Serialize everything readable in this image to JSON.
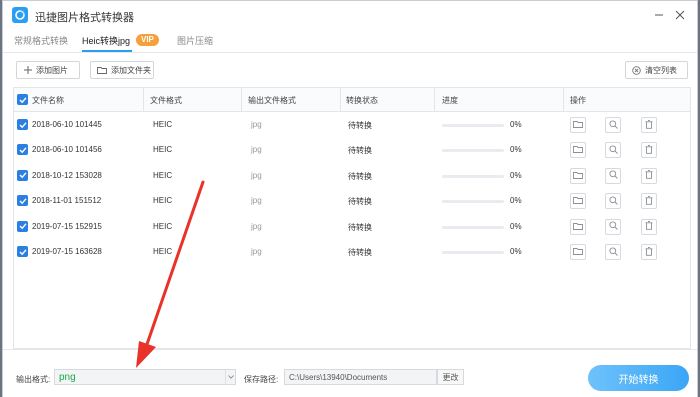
{
  "window": {
    "title": "迅捷图片格式转换器"
  },
  "tabs": [
    {
      "label": "常规格式转换"
    },
    {
      "label": "Heic转换jpg",
      "badge": "VIP"
    },
    {
      "label": "图片压缩"
    }
  ],
  "toolbar": {
    "add_image": "添加图片",
    "add_folder": "添加文件夹",
    "clear_list": "清空列表"
  },
  "table": {
    "headers": {
      "name": "文件名称",
      "format": "文件格式",
      "output_format": "输出文件格式",
      "status": "转换状态",
      "progress": "进度",
      "actions": "操作"
    },
    "rows": [
      {
        "name": "2018-06-10 101445",
        "format": "HEIC",
        "output": "jpg",
        "status": "待转换",
        "progress": "0%",
        "progress_value": 0
      },
      {
        "name": "2018-06-10 101456",
        "format": "HEIC",
        "output": "jpg",
        "status": "待转换",
        "progress": "0%",
        "progress_value": 0
      },
      {
        "name": "2018-10-12 153028",
        "format": "HEIC",
        "output": "jpg",
        "status": "待转换",
        "progress": "0%",
        "progress_value": 0
      },
      {
        "name": "2018-11-01 151512",
        "format": "HEIC",
        "output": "jpg",
        "status": "待转换",
        "progress": "0%",
        "progress_value": 0
      },
      {
        "name": "2019-07-15 152915",
        "format": "HEIC",
        "output": "jpg",
        "status": "待转换",
        "progress": "0%",
        "progress_value": 0
      },
      {
        "name": "2019-07-15 163628",
        "format": "HEIC",
        "output": "jpg",
        "status": "待转换",
        "progress": "0%",
        "progress_value": 0
      }
    ]
  },
  "bottom": {
    "output_format_label": "输出格式:",
    "output_format_value": "png",
    "save_path_label": "保存路径:",
    "save_path_value": "C:\\Users\\13940\\Documents",
    "change_button": "更改",
    "start_button": "开始转换"
  },
  "colors": {
    "accent": "#2a9df4",
    "vip": "#f5a03a",
    "checkbox": "#2a7fe0",
    "format_value": "#1aa84a",
    "annotation_arrow": "#e8322a"
  },
  "icons": {
    "logo": "app-logo-icon",
    "minimize": "minimize-icon",
    "close": "close-icon",
    "add": "plus-icon",
    "folder": "folder-icon",
    "clear": "clear-icon",
    "preview": "search-icon",
    "delete": "trash-icon"
  }
}
